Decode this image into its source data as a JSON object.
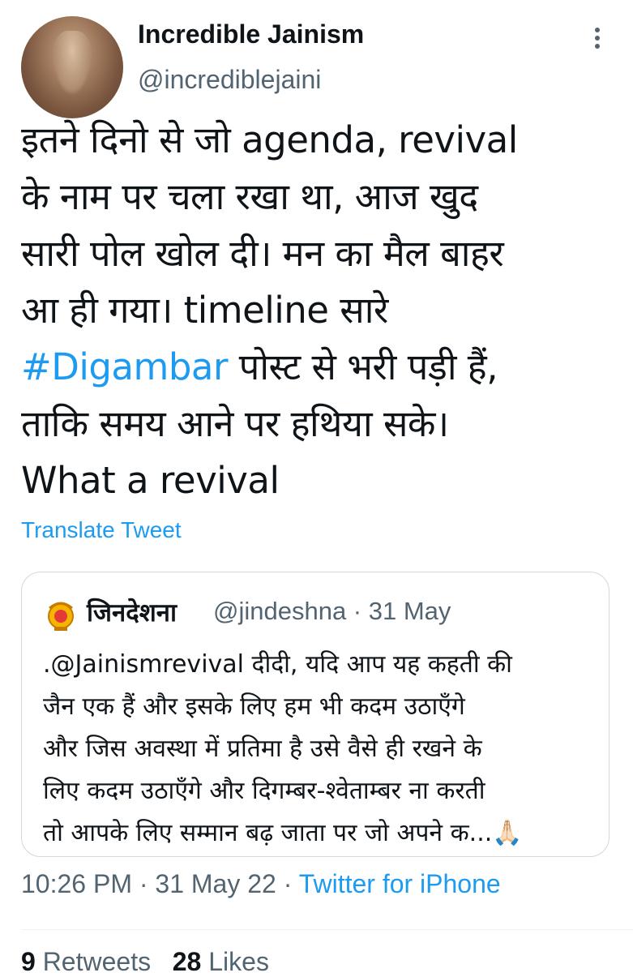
{
  "author": {
    "name": "Incredible Jainism",
    "handle": "@incrediblejaini"
  },
  "tweet": {
    "lines": [
      "इतने दिनो से जो agenda, revival",
      "के नाम पर चला रखा था, आज खुद",
      "सारी पोल खोल दी। मन का मैल बाहर",
      "आ ही गया। timeline सारे"
    ],
    "hashtag": "#Digambar",
    "hashtag_rest": " पोस्ट से भरी पड़ी हैं,",
    "lines_after": [
      "ताकि समय आने पर हथिया सके।",
      "What a revival"
    ],
    "translate_label": "Translate Tweet"
  },
  "quoted": {
    "name": "जिनदेशना",
    "meta": "@jindeshna · 31 May",
    "lines": [
      ".@Jainismrevival दीदी, यदि आप यह कहती की",
      "जैन एक हैं और इसके लिए हम भी कदम उठाएँगे",
      "और जिस अवस्था में प्रतिमा है उसे वैसे ही रखने के",
      "लिए कदम उठाएँगे और दिगम्बर-श्वेताम्बर ना करती",
      "तो आपके लिए सम्मान बढ़ जाता पर जो अपने क...🙏🏻"
    ]
  },
  "footer": {
    "time": "10:26 PM · 31 May 22 · ",
    "source": "Twitter for iPhone"
  },
  "stats": {
    "retweets_count": "9",
    "retweets_label": "Retweets",
    "likes_count": "28",
    "likes_label": "Likes"
  },
  "icons": {
    "more": "more-vertical-icon",
    "quoted_avatar": "emblem-icon"
  },
  "colors": {
    "link": "#1d9bf0",
    "secondary": "#536471",
    "text": "#0f1419"
  }
}
